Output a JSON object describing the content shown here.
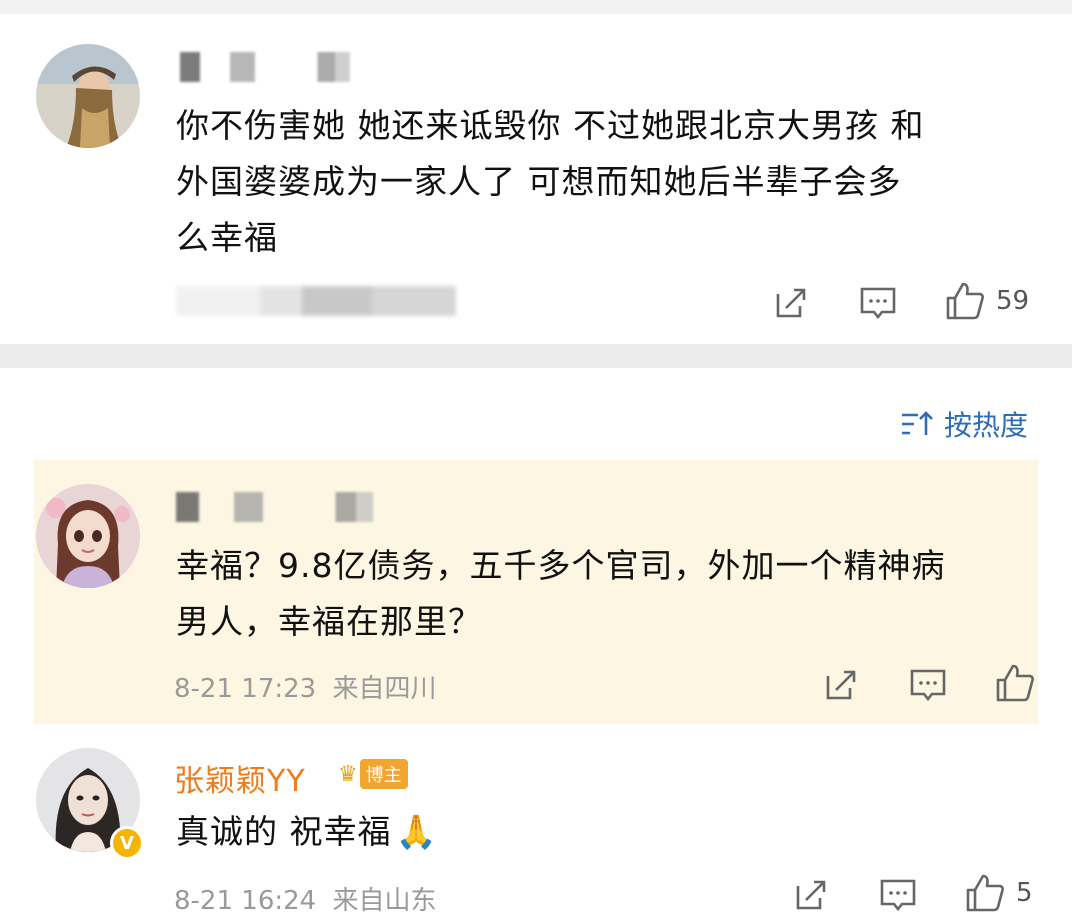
{
  "comment1": {
    "text_lines": [
      "你不伤害她 她还来诋毁你 不过她跟北京大男孩 和",
      "外国婆婆成为一家人了 可想而知她后半辈子会多",
      "么幸福"
    ],
    "like_count": "59"
  },
  "sort": {
    "label": "按热度"
  },
  "comment2": {
    "text_lines": [
      "幸福？9.8亿债务，五千多个官司，外加一个精神病",
      "男人，幸福在那里？"
    ],
    "timestamp": "8-21 17:23",
    "location": "来自四川"
  },
  "comment3": {
    "author": "张颖颖YY",
    "badge": "博主",
    "text": "真诚的 祝幸福",
    "emoji": "🙏",
    "timestamp": "8-21 16:24",
    "location": "来自山东",
    "like_count": "5"
  },
  "colors": {
    "link_blue": "#2e6db4",
    "vip_orange": "#f07b1a",
    "highlight_bg": "#fcf6e3"
  },
  "icons": [
    "share-icon",
    "comment-icon",
    "thumb-up-icon",
    "sort-icon",
    "crown-icon",
    "verified-icon",
    "pray-emoji"
  ]
}
